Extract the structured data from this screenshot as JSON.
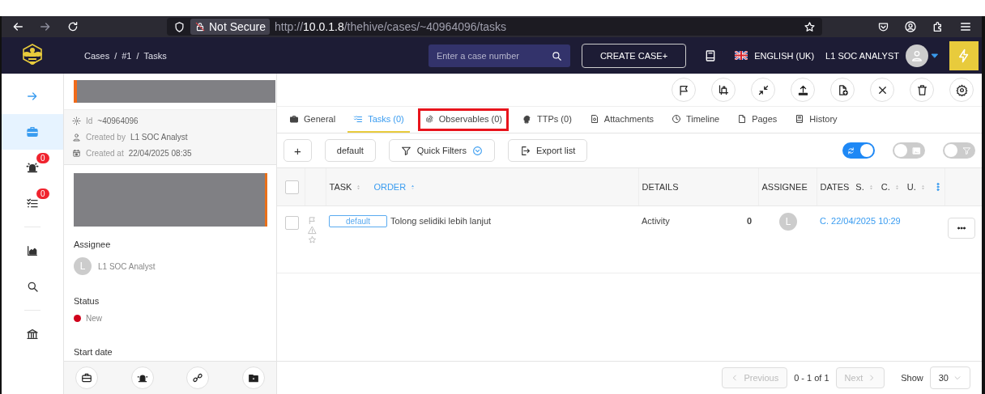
{
  "browser": {
    "security": "Not Secure",
    "url_scheme": "http://",
    "url_host": "10.0.1.8",
    "url_path": "/thehive/cases/~40964096/tasks",
    "forward_disabled": true
  },
  "header": {
    "breadcrumb": [
      "Cases",
      "#1",
      "Tasks"
    ],
    "breadcrumb_separator": "/",
    "search": {
      "placeholder": "Enter a case number"
    },
    "create_button": "CREATE CASE+",
    "language": "ENGLISH (UK)",
    "user": "L1 SOC ANALYST"
  },
  "nav": [
    {
      "kind": "expand",
      "selected": false
    },
    {
      "kind": "cases",
      "selected": true
    },
    {
      "kind": "alerts",
      "selected": false,
      "badge": "0"
    },
    {
      "kind": "tasks",
      "selected": false,
      "badge": "0"
    },
    {
      "kind": "dashboards",
      "selected": false
    },
    {
      "kind": "search",
      "selected": false
    },
    {
      "kind": "organisation",
      "selected": false
    }
  ],
  "case": {
    "fields": [
      {
        "kind": "id",
        "label": "Id",
        "value": "~40964096"
      },
      {
        "kind": "creator",
        "label": "Created by",
        "value": "L1 SOC Analyst"
      },
      {
        "kind": "date",
        "label": "Created at",
        "value": "22/04/2025 08:35"
      }
    ],
    "assignee_label": "Assignee",
    "assignee_initial": "L",
    "assignee": "L1 SOC Analyst",
    "status_label": "Status",
    "status": {
      "text": "New",
      "color": "#d0021b"
    },
    "start_date_label": "Start date"
  },
  "case_tools": [
    {
      "kind": "case"
    },
    {
      "kind": "alert"
    },
    {
      "kind": "link"
    },
    {
      "kind": "folder"
    }
  ],
  "actions": [
    {
      "kind": "flag"
    },
    {
      "kind": "merge"
    },
    {
      "kind": "collapse"
    },
    {
      "kind": "export"
    },
    {
      "kind": "add-file"
    },
    {
      "kind": "close"
    },
    {
      "kind": "delete"
    },
    {
      "kind": "settings"
    }
  ],
  "tabs": [
    {
      "kind": "general",
      "label": "General",
      "selected": false,
      "highlighted": false
    },
    {
      "kind": "tasks",
      "label": "Tasks (0)",
      "selected": true,
      "highlighted": false
    },
    {
      "kind": "observables",
      "label": "Observables (0)",
      "selected": false,
      "highlighted": true
    },
    {
      "kind": "ttps",
      "label": "TTPs (0)",
      "selected": false,
      "highlighted": false
    },
    {
      "kind": "attachments",
      "label": "Attachments",
      "selected": false,
      "highlighted": false
    },
    {
      "kind": "timeline",
      "label": "Timeline",
      "selected": false,
      "highlighted": false
    },
    {
      "kind": "pages",
      "label": "Pages",
      "selected": false,
      "highlighted": false
    },
    {
      "kind": "history",
      "label": "History",
      "selected": false,
      "highlighted": false
    }
  ],
  "toolbar": {
    "add": "+",
    "filter": "default",
    "quick_filters": "Quick Filters",
    "export": "Export list",
    "toggles": [
      {
        "kind": "refresh",
        "on": true
      },
      {
        "kind": "picture",
        "on": false
      },
      {
        "kind": "filter",
        "on": false
      }
    ]
  },
  "table": {
    "all_selected": false,
    "headers": {
      "task": "TASK",
      "order": "ORDER",
      "order_sorted": true,
      "details": "DETAILS",
      "assignee": "ASSIGNEE",
      "dates": "DATES",
      "date_sorts": [
        "S.",
        "C.",
        "U."
      ]
    },
    "rows": [
      {
        "selected": false,
        "group": "default",
        "title": "Tolong selidiki lebih lanjut",
        "details": "Activity",
        "count": "0",
        "assignee_initial": "L",
        "date": "C. 22/04/2025 10:29"
      }
    ]
  },
  "pagination": {
    "previous": "Previous",
    "previous_disabled": true,
    "range": "0 - 1 of 1",
    "next": "Next",
    "next_disabled": true,
    "show_label": "Show",
    "page_size": "30"
  }
}
